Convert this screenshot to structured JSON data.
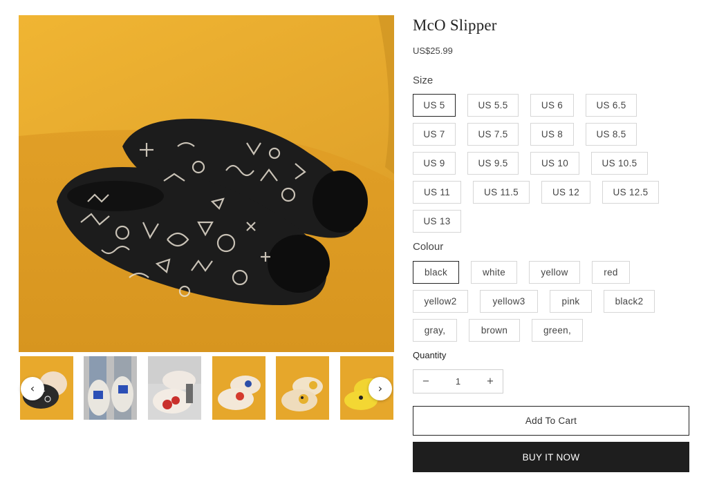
{
  "product": {
    "title": "McO Slipper",
    "price": "US$25.99"
  },
  "size": {
    "label": "Size",
    "options": [
      "US 5",
      "US 5.5",
      "US 6",
      "US 6.5",
      "US 7",
      "US 7.5",
      "US 8",
      "US 8.5",
      "US 9",
      "US 9.5",
      "US 10",
      "US 10.5",
      "US 11",
      "US 11.5",
      "US 12",
      "US 12.5",
      "US 13"
    ],
    "selected": "US 5"
  },
  "colour": {
    "label": "Colour",
    "options": [
      "black",
      "white",
      "yellow",
      "red",
      "yellow2",
      "yellow3",
      "pink",
      "black2",
      "gray,",
      "brown",
      "green,"
    ],
    "selected": "black"
  },
  "quantity": {
    "label": "Quantity",
    "value": "1",
    "minus": "−",
    "plus": "+"
  },
  "actions": {
    "add_to_cart": "Add To Cart",
    "buy_now": "BUY IT NOW"
  },
  "gallery": {
    "prev_icon": "chevron-left-icon",
    "next_icon": "chevron-right-icon",
    "prev_glyph": "‹",
    "next_glyph": "›",
    "thumbnails": [
      "thumbnail-1",
      "thumbnail-2",
      "thumbnail-3",
      "thumbnail-4",
      "thumbnail-5",
      "thumbnail-6"
    ]
  },
  "colors": {
    "background_mustard": "#e9ad2a",
    "slipper_black": "#1c1c1c",
    "button_dark": "#1e1e1e",
    "border_light": "#d6d6d6"
  }
}
